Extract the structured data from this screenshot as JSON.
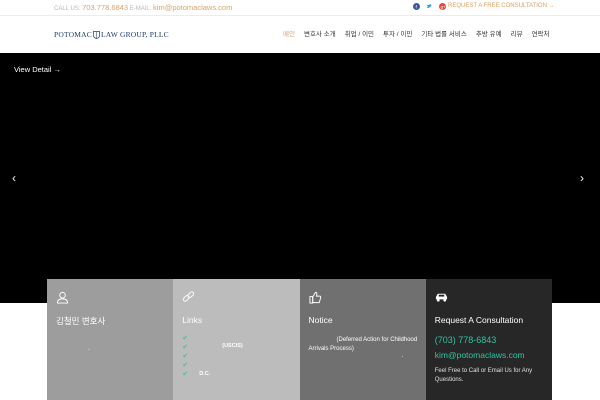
{
  "topbar": {
    "call_label": "CALL US:",
    "phone": "703.778.6843",
    "email_label": "E-MAIL:",
    "email": "kim@potomaclaws.com",
    "request_link": "REQUEST A FREE CONSULTATION →"
  },
  "header": {
    "logo_text_left": "POTOMAC",
    "logo_text_right": "LAW GROUP, PLLC",
    "nav": [
      "메인",
      "변호사 소개",
      "취업 / 이민",
      "투자 / 이민",
      "기타 법률 서비스",
      "추방 유예",
      "리뷰",
      "연락처"
    ]
  },
  "hero": {
    "detail_link": "View Detail →",
    "prev_arrow": "‹",
    "next_arrow": "›"
  },
  "cards": {
    "attorney": {
      "title": "김철민 변호사",
      "dot": "."
    },
    "links": {
      "title": "Links",
      "uscis": "(USCIS)",
      "dc": "D.C.",
      "check": "✔"
    },
    "notice": {
      "title": "Notice",
      "daca": "(Deferred Action for Childhood Arrivals Process)",
      "dot": "."
    },
    "consult": {
      "title": "Request A Consultation",
      "phone": "(703) 778-6843",
      "email": "kim@potomaclaws.com",
      "note": "Feel Free to Call or Email Us for Any Questions."
    }
  },
  "colors": {
    "accent": "#d9a36a",
    "teal": "#2ec4a5",
    "check_green": "#3fc78a"
  },
  "icons": [
    "user-icon",
    "link-icon",
    "thumbs-up-icon",
    "car-icon",
    "facebook-icon",
    "twitter-icon",
    "google-plus-icon"
  ]
}
